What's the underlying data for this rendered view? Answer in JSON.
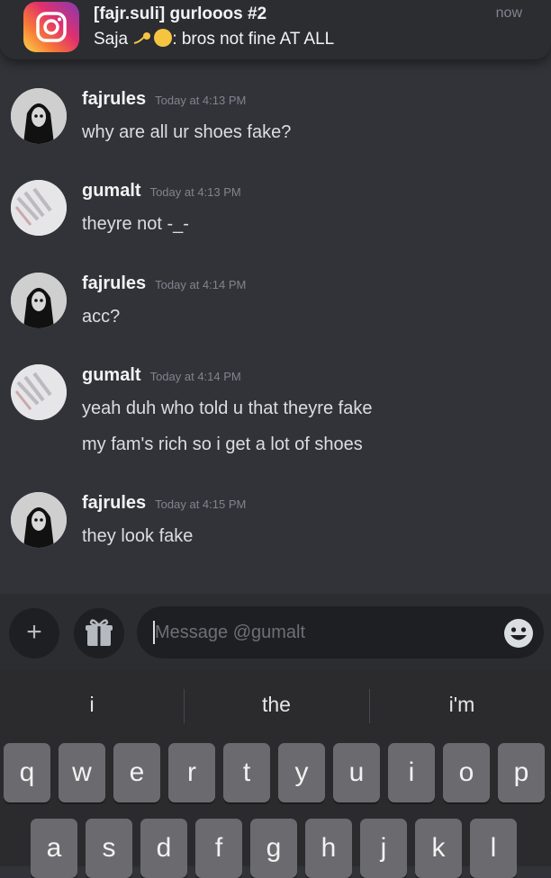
{
  "notification": {
    "app_icon": "instagram-icon",
    "title": "[fajr.suli] gurlooos #2",
    "sender": "Saja",
    "body": ": bros not fine AT ALL",
    "time": "now"
  },
  "messages": [
    {
      "author": "fajrules",
      "timestamp": "Today at 4:13 PM",
      "lines": [
        "why are all ur shoes fake?"
      ],
      "avatar": "dark-avatar"
    },
    {
      "author": "gumalt",
      "timestamp": "Today at 4:13 PM",
      "lines": [
        "theyre not -_-"
      ],
      "avatar": "light-avatar"
    },
    {
      "author": "fajrules",
      "timestamp": "Today at 4:14 PM",
      "lines": [
        "acc?"
      ],
      "avatar": "dark-avatar"
    },
    {
      "author": "gumalt",
      "timestamp": "Today at 4:14 PM",
      "lines": [
        "yeah duh who told u that theyre fake",
        "my fam's rich so i get a lot of shoes"
      ],
      "avatar": "light-avatar"
    },
    {
      "author": "fajrules",
      "timestamp": "Today at 4:15 PM",
      "lines": [
        "they look fake"
      ],
      "avatar": "dark-avatar"
    }
  ],
  "composer": {
    "add_icon": "plus-icon",
    "gift_icon": "gift-icon",
    "placeholder": "Message @gumalt",
    "emoji_icon": "emoji-icon"
  },
  "keyboard": {
    "suggestions": [
      "i",
      "the",
      "i'm"
    ],
    "row1": [
      "q",
      "w",
      "e",
      "r",
      "t",
      "y",
      "u",
      "i",
      "o",
      "p"
    ],
    "row2": [
      "a",
      "s",
      "d",
      "f",
      "g",
      "h",
      "j",
      "k",
      "l"
    ]
  },
  "colors": {
    "background": "#313338",
    "composer": "#2b2d31",
    "input": "#1e1f22",
    "keyboard": "#2b2b2e",
    "key": "#6b6b6f"
  }
}
